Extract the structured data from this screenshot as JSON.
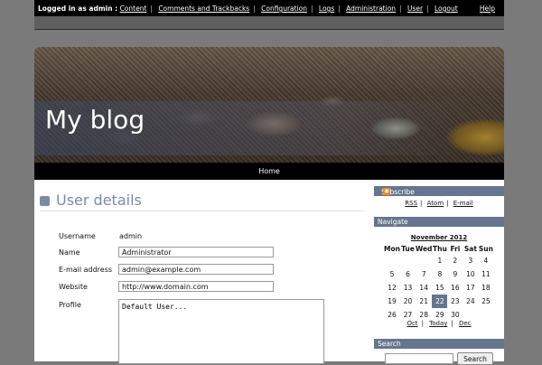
{
  "admin_bar": {
    "logged_in_as": "Logged in as admin :",
    "links": [
      "Content",
      "Comments and Trackbacks",
      "Configuration",
      "Logs",
      "Administration",
      "User",
      "Logout"
    ],
    "help": "Help"
  },
  "header": {
    "blog_title": "My blog"
  },
  "nav": {
    "home": "Home"
  },
  "page": {
    "heading": "User details",
    "username_label": "Username",
    "username_value": "admin",
    "name_label": "Name",
    "name_value": "Administrator",
    "email_label": "E-mail address",
    "email_value": "admin@example.com",
    "website_label": "Website",
    "website_value": "http://www.domain.com",
    "profile_label": "Profile",
    "profile_value": "Default User..."
  },
  "sidebar": {
    "subscribe": {
      "title": "Subscribe",
      "icon": "rss-icon",
      "links": [
        "RSS",
        "Atom",
        "E-mail"
      ]
    },
    "navigate": {
      "title": "Navigate",
      "month": "November 2012",
      "weekdays": [
        "Mon",
        "Tue",
        "Wed",
        "Thu",
        "Fri",
        "Sat",
        "Sun"
      ],
      "weeks": [
        [
          "",
          "",
          "",
          "1",
          "2",
          "3",
          "4"
        ],
        [
          "5",
          "6",
          "7",
          "8",
          "9",
          "10",
          "11"
        ],
        [
          "12",
          "13",
          "14",
          "15",
          "16",
          "17",
          "18"
        ],
        [
          "19",
          "20",
          "21",
          "22",
          "23",
          "24",
          "25"
        ],
        [
          "26",
          "27",
          "28",
          "29",
          "30",
          "",
          ""
        ]
      ],
      "today": "22",
      "prev": "Oct",
      "today_link": "Today",
      "next": "Dec"
    },
    "search": {
      "title": "Search",
      "button": "Search"
    }
  },
  "colors": {
    "accent": "#66758f",
    "heading": "#7d8aa6",
    "background": "#7a7a7a"
  }
}
